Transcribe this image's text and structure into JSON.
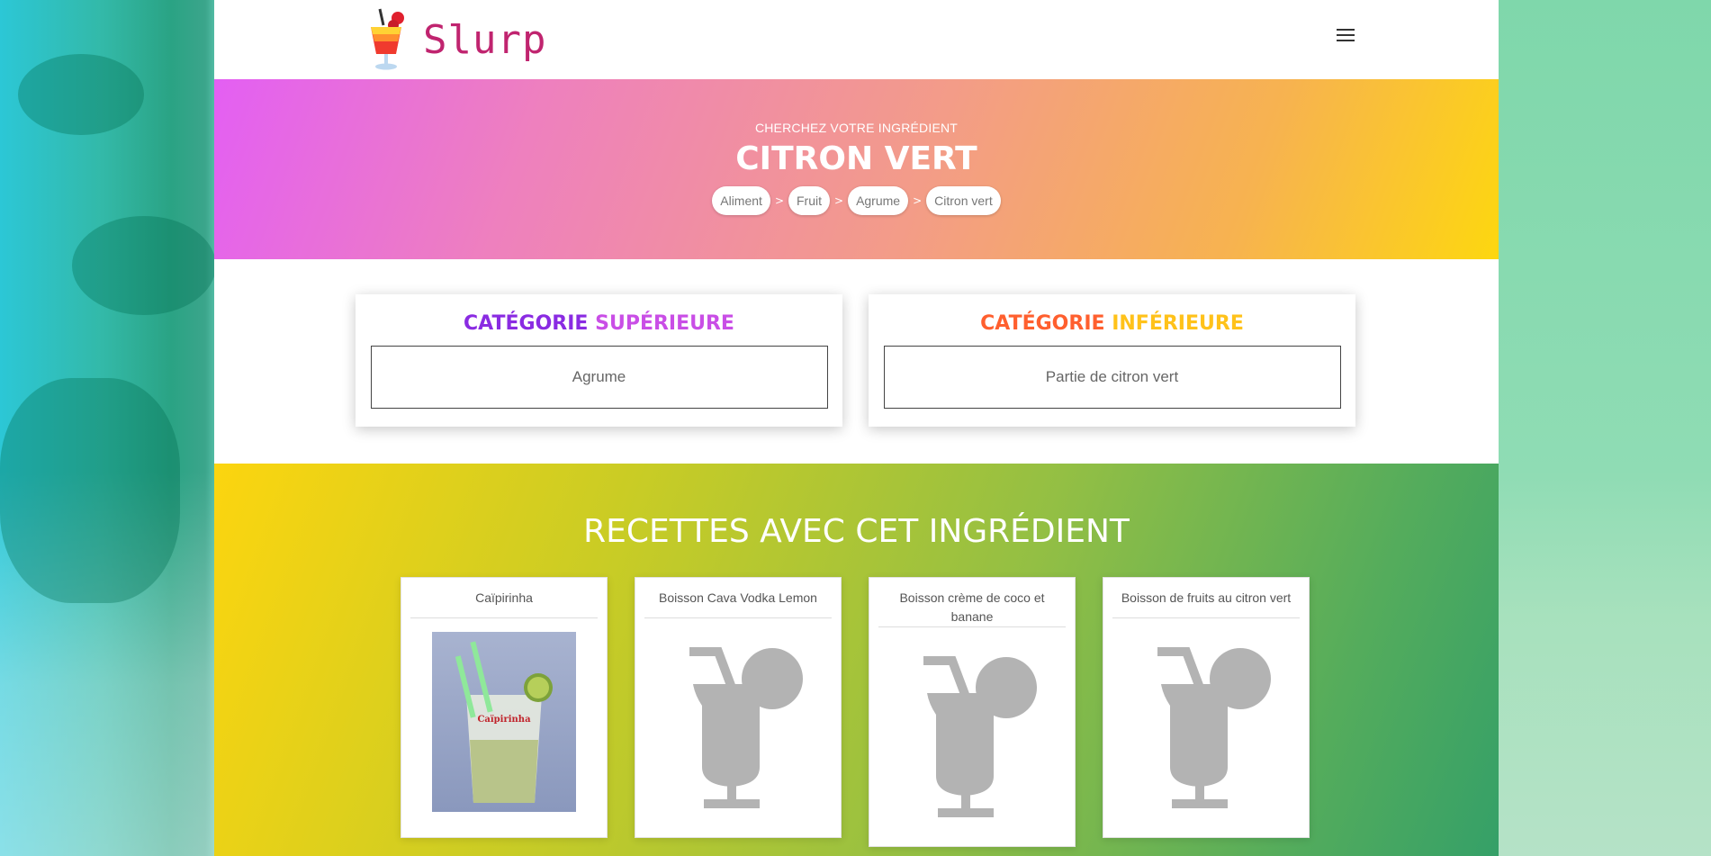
{
  "brand": {
    "name": "Slurp"
  },
  "hero": {
    "subtitle": "CHERCHEZ VOTRE INGRÉDIENT",
    "title": "CITRON VERT",
    "breadcrumb": [
      "Aliment",
      "Fruit",
      "Agrume",
      "Citron vert"
    ],
    "separator": ">"
  },
  "categories": {
    "upper": {
      "title_a": "CATÉGORIE ",
      "title_b": "SUPÉRIEURE",
      "item": "Agrume"
    },
    "lower": {
      "title_a": "CATÉGORIE ",
      "title_b": "INFÉRIEURE",
      "item": "Partie de citron vert"
    }
  },
  "recipes": {
    "title": "RECETTES AVEC CET INGRÉDIENT",
    "cards": [
      {
        "name": "Caïpirinha",
        "image": "caipirinha-photo",
        "photo_label": "Caïpirinha"
      },
      {
        "name": "Boisson Cava Vodka Lemon",
        "image": "cocktail-placeholder-icon"
      },
      {
        "name": "Boisson crème de coco et banane",
        "image": "cocktail-placeholder-icon"
      },
      {
        "name": "Boisson de fruits au citron vert",
        "image": "cocktail-placeholder-icon"
      }
    ]
  },
  "colors": {
    "upper_title_a": "#8a2be2",
    "upper_title_b": "#c94ee6",
    "lower_title_a": "#ff5f2e",
    "lower_title_b": "#ffc21a",
    "brand": "#c0246f"
  }
}
